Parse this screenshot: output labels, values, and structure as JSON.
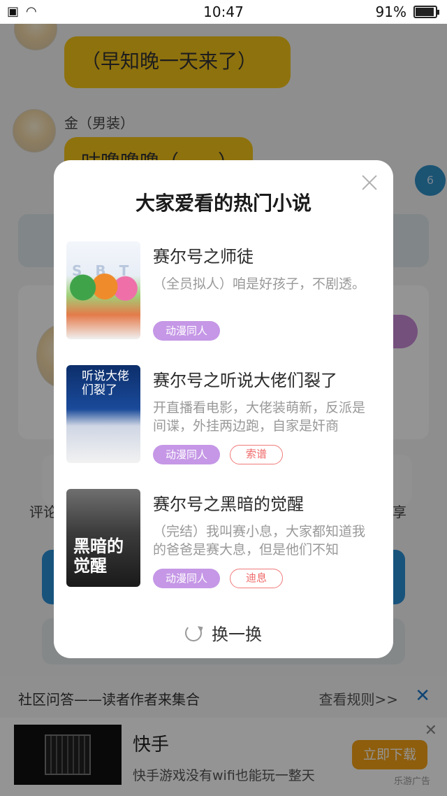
{
  "status_bar": {
    "time": "10:47",
    "battery": "91%"
  },
  "chat": {
    "msg1_bubble": "（早知晚一天来了）",
    "msg2_nick": "金（男装）",
    "msg2_bubble": "咕噜噜噜（……）",
    "unread_badge": "6",
    "side_label_left": "评论",
    "side_label_right": "享"
  },
  "modal": {
    "title": "大家爱看的热门小说",
    "novels": [
      {
        "title": "赛尔号之师徒",
        "desc": "（全员拟人）咱是好孩子，不剧透。",
        "tag": "动漫同人",
        "author": "",
        "cover_text": "S B T"
      },
      {
        "title": "赛尔号之听说大佬们裂了",
        "desc": "开直播看电影，大佬装萌新，反派是间谍，外挂两边跑，自家是奸商",
        "tag": "动漫同人",
        "author": "索谱",
        "cover_text": "听说大佬们裂了"
      },
      {
        "title": "赛尔号之黑暗的觉醒",
        "desc": "（完结）我叫赛小息，大家都知道我的爸爸是赛大息，但是他们不知",
        "tag": "动漫同人",
        "author": "迪息",
        "cover_text": "黑暗的觉醒"
      }
    ],
    "refresh_label": "换一换"
  },
  "community": {
    "title": "社区问答——读者作者来集合",
    "link": "查看规则>>"
  },
  "ad": {
    "title": "快手",
    "desc": "快手游戏没有wifi也能玩一整天",
    "button": "立即下载",
    "label": "乐游广告"
  },
  "colors": {
    "accent_blue": "#2a8fd6",
    "bubble_yellow": "#f5c519",
    "tag_purple": "#c597e6",
    "tag_red": "#f07a7a",
    "ad_orange": "#f5a317"
  }
}
